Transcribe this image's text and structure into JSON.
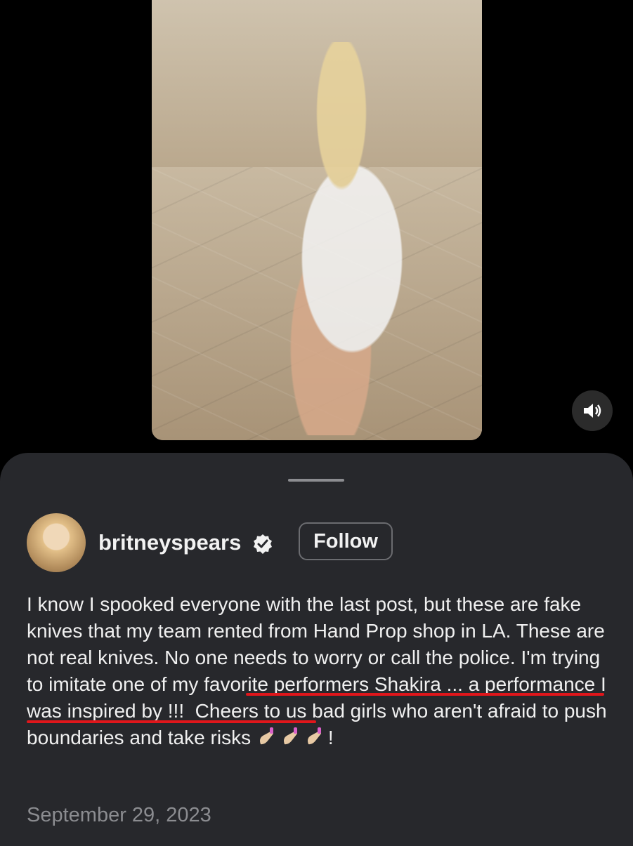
{
  "post": {
    "username": "britneyspears",
    "follow_label": "Follow",
    "caption_parts": {
      "lead": "I know I spooked everyone with the last post, but these are fake knives that my team rented from Hand Prop shop in LA. These are not real knives. No one needs to worry or call the police",
      "highlight": ". I'm trying to imitate one of my favorite performers Shakira",
      "tail": " ... a performance I was inspired by !!!  Cheers to us bad girls who aren't afraid to push boundaries and take risks ",
      "end": "!"
    },
    "emoji_name": "nail-polish-emoji",
    "date": "September 29, 2023"
  },
  "icons": {
    "sound": "speaker-icon",
    "verified": "verified-badge-icon"
  },
  "colors": {
    "sheet_bg": "#27282c",
    "underline": "#e0161b",
    "date": "#8b8c90"
  }
}
